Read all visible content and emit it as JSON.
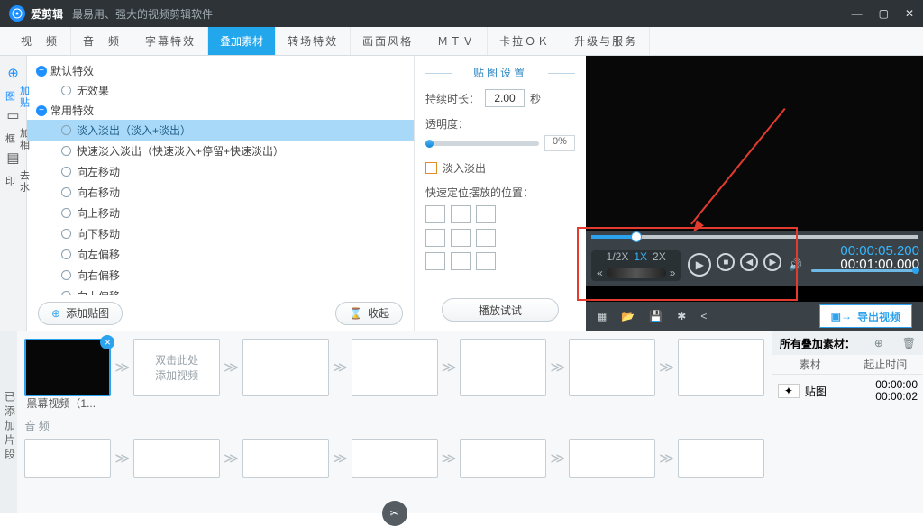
{
  "title": "爱剪辑",
  "tagline": "最易用、强大的视频剪辑软件",
  "winbtns": {
    "min": "—",
    "max": "▢",
    "close": "✕"
  },
  "tabs": [
    "视　频",
    "音　频",
    "字幕特效",
    "叠加素材",
    "转场特效",
    "画面风格",
    "ＭＴＶ",
    "卡拉ＯＫ",
    "升级与服务"
  ],
  "tabs_active_index": 3,
  "sidetools": [
    {
      "icon": "⊕",
      "label": "加贴图",
      "active": true
    },
    {
      "icon": "▭",
      "label": "加相框",
      "active": false
    },
    {
      "icon": "▤",
      "label": "去水印",
      "active": false
    }
  ],
  "fxgroups": [
    {
      "name": "默认特效",
      "items": [
        "无效果"
      ]
    },
    {
      "name": "常用特效",
      "items": [
        "淡入淡出（淡入+淡出）",
        "快速淡入淡出（快速淡入+停留+快速淡出）",
        "向左移动",
        "向右移动",
        "向上移动",
        "向下移动",
        "向左偏移",
        "向右偏移",
        "向上偏移"
      ],
      "selected": 0
    }
  ],
  "fx_add_btn": "添加贴图",
  "fx_collapse_btn": "收起",
  "opt": {
    "head": "贴图设置",
    "dur_label": "持续时长：",
    "dur_value": "2.00",
    "dur_unit": "秒",
    "opa_label": "透明度：",
    "opa_value": "0%",
    "fade_label": "淡入淡出",
    "pos_label": "快速定位摆放的位置：",
    "try_btn": "播放试试"
  },
  "player": {
    "speeds": [
      "1/2X",
      "1X",
      "2X"
    ],
    "speed_active": 1,
    "elapsed": "00:00:05.200",
    "total": "00:01:00.000",
    "export": "导出视频"
  },
  "added_label": "已添加片段",
  "clips": {
    "first_label": "黑幕视频（1...",
    "second_hint": "双击此处\n添加视频",
    "audio_label": "音 频"
  },
  "overlay": {
    "title": "所有叠加素材：",
    "col1": "素材",
    "col2": "起止时间",
    "row_name": "贴图",
    "row_t1": "00:00:00",
    "row_t2": "00:00:02"
  }
}
